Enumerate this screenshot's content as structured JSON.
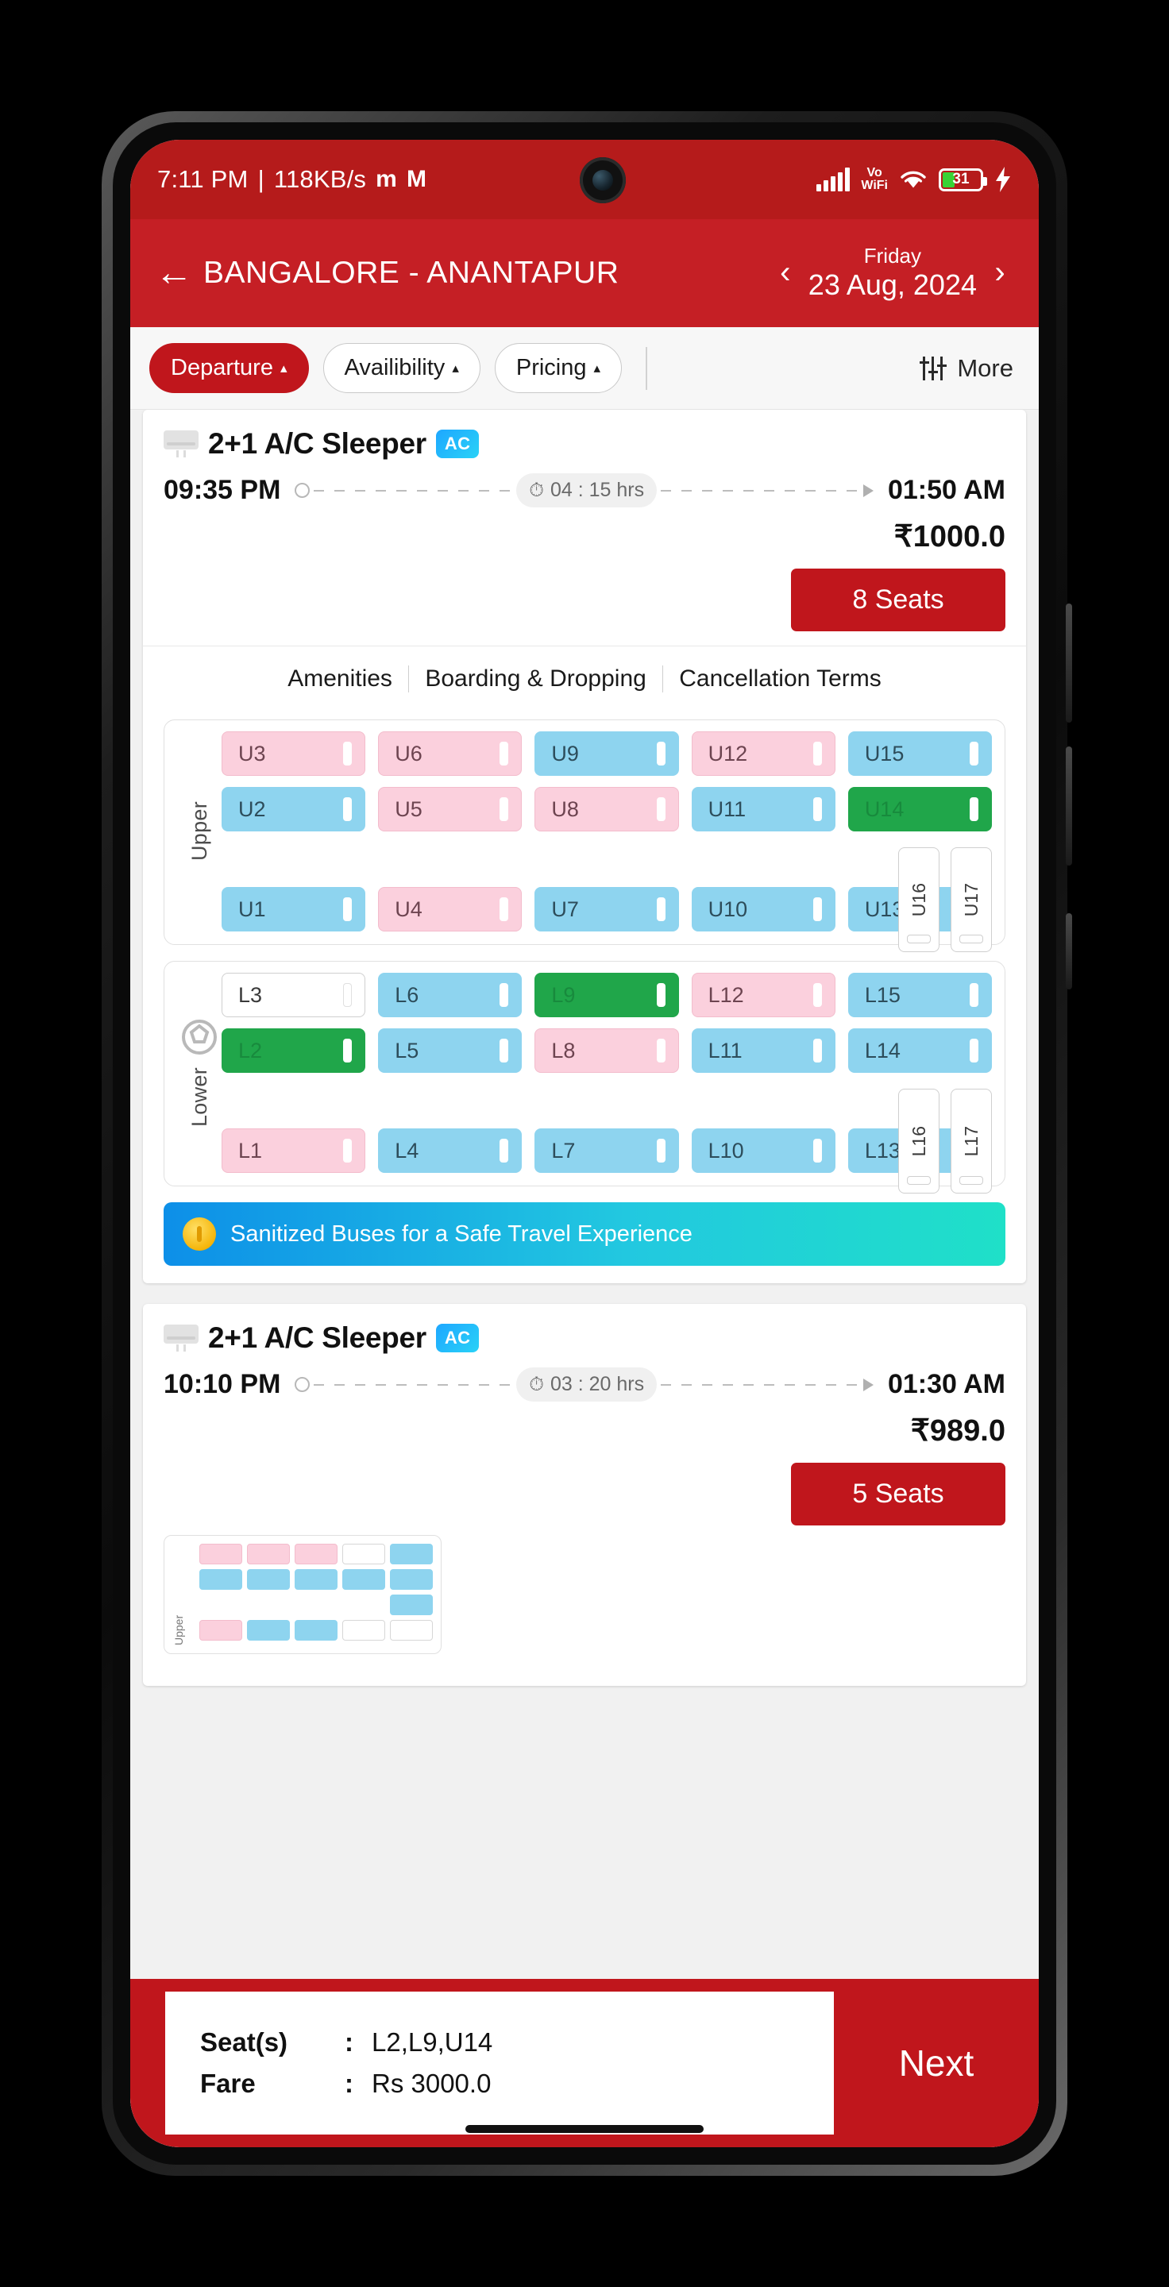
{
  "status_bar": {
    "time": "7:11 PM",
    "separator": "|",
    "network_speed": "118KB/s",
    "app_icon_1": "m",
    "app_icon_2": "M",
    "signal_icon": "signal-bars-icon",
    "volte_line1": "Vo",
    "volte_line2": "WiFi",
    "wifi_icon": "wifi-icon",
    "battery_percent": "31",
    "charging_icon": "charging-bolt-icon",
    "bar_color": "#b51b1b"
  },
  "header": {
    "back_icon": "back-arrow-icon",
    "route": "BANGALORE - ANANTAPUR",
    "prev_day_icon": "chevron-left-icon",
    "next_day_icon": "chevron-right-icon",
    "day_of_week": "Friday",
    "date": "23 Aug, 2024",
    "bg_color": "#c51f25"
  },
  "filters": {
    "chips": [
      {
        "label": "Departure",
        "active": true,
        "caret": "▴"
      },
      {
        "label": "Availibility",
        "active": false,
        "caret": "▴"
      },
      {
        "label": "Pricing",
        "active": false,
        "caret": "▴"
      }
    ],
    "more_label": "More",
    "more_icon": "sliders-icon"
  },
  "buses": [
    {
      "icon": "ac-unit-icon",
      "type": "2+1 A/C Sleeper",
      "ac_badge": "AC",
      "departure_time": "09:35 PM",
      "duration": "04 : 15 hrs",
      "duration_icon": "stopwatch-icon",
      "arrival_time": "01:50 AM",
      "fare": "₹1000.0",
      "seats_button": "8 Seats",
      "tabs": [
        "Amenities",
        "Boarding & Dropping",
        "Cancellation Terms"
      ]
    },
    {
      "icon": "ac-unit-icon",
      "type": "2+1 A/C Sleeper",
      "ac_badge": "AC",
      "departure_time": "10:10 PM",
      "duration": "03 : 20 hrs",
      "duration_icon": "stopwatch-icon",
      "arrival_time": "01:30 AM",
      "fare": "₹989.0",
      "seats_button": "5 Seats"
    }
  ],
  "seatmap": {
    "upper": {
      "deck_label": "Upper",
      "rows": [
        [
          {
            "id": "U3",
            "state": "pink"
          },
          {
            "id": "U6",
            "state": "pink"
          },
          {
            "id": "U9",
            "state": "blue"
          },
          {
            "id": "U12",
            "state": "pink"
          },
          {
            "id": "U15",
            "state": "blue"
          }
        ],
        [
          {
            "id": "U2",
            "state": "blue"
          },
          {
            "id": "U5",
            "state": "pink"
          },
          {
            "id": "U8",
            "state": "pink"
          },
          {
            "id": "U11",
            "state": "blue"
          },
          {
            "id": "U14",
            "state": "green"
          }
        ],
        [
          {
            "id": "U1",
            "state": "blue"
          },
          {
            "id": "U4",
            "state": "pink"
          },
          {
            "id": "U7",
            "state": "blue"
          },
          {
            "id": "U10",
            "state": "blue"
          },
          {
            "id": "U13",
            "state": "blue"
          }
        ]
      ],
      "rear": [
        {
          "id": "U16",
          "state": "white"
        },
        {
          "id": "U17",
          "state": "white"
        }
      ]
    },
    "lower": {
      "deck_label": "Lower",
      "driver_icon": "steering-wheel-icon",
      "rows": [
        [
          {
            "id": "L3",
            "state": "white"
          },
          {
            "id": "L6",
            "state": "blue"
          },
          {
            "id": "L9",
            "state": "green"
          },
          {
            "id": "L12",
            "state": "pink"
          },
          {
            "id": "L15",
            "state": "blue"
          }
        ],
        [
          {
            "id": "L2",
            "state": "green"
          },
          {
            "id": "L5",
            "state": "blue"
          },
          {
            "id": "L8",
            "state": "pink"
          },
          {
            "id": "L11",
            "state": "blue"
          },
          {
            "id": "L14",
            "state": "blue"
          }
        ],
        [
          {
            "id": "L1",
            "state": "pink"
          },
          {
            "id": "L4",
            "state": "blue"
          },
          {
            "id": "L7",
            "state": "blue"
          },
          {
            "id": "L10",
            "state": "blue"
          },
          {
            "id": "L13",
            "state": "blue"
          }
        ]
      ],
      "rear": [
        {
          "id": "L16",
          "state": "white"
        },
        {
          "id": "L17",
          "state": "white"
        }
      ]
    },
    "colors": {
      "ladies": "#fbd0dd",
      "available": "#8ed4ef",
      "selected": "#20a64a",
      "booked": "#ffffff"
    }
  },
  "banner": {
    "icon": "medal-icon",
    "text": "Sanitized Buses for a Safe Travel Experience"
  },
  "bottom_bar": {
    "seats_key": "Seat(s)",
    "seats_colon": ":",
    "seats_value": "L2,L9,U14",
    "fare_key": "Fare",
    "fare_colon": ":",
    "fare_value": "Rs 3000.0",
    "next_label": "Next",
    "bg_color": "#c0161c"
  }
}
